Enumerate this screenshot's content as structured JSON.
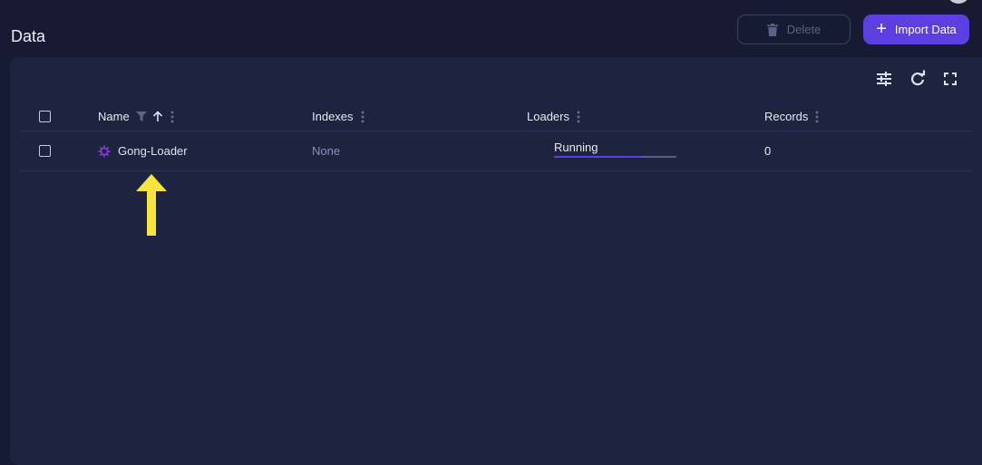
{
  "page": {
    "title": "Data"
  },
  "toolbar": {
    "delete_label": "Delete",
    "import_label": "Import Data",
    "icons": [
      "trash-icon",
      "plus-icon"
    ]
  },
  "table_tools": {
    "icons": [
      "column-settings-icon",
      "refresh-icon",
      "fullscreen-icon"
    ]
  },
  "table": {
    "columns": [
      {
        "label": "Name",
        "icons": [
          "filter-icon",
          "sort-asc-icon",
          "column-menu-icon"
        ]
      },
      {
        "label": "Indexes",
        "icons": [
          "column-menu-icon"
        ]
      },
      {
        "label": "Loaders",
        "icons": [
          "column-menu-icon"
        ]
      },
      {
        "label": "Records",
        "icons": [
          "column-menu-icon"
        ]
      }
    ],
    "rows": [
      {
        "name": "Gong-Loader",
        "icon": "loader-gear-icon",
        "indexes": "None",
        "loader_status": "Running",
        "loader_progress": 0.71,
        "records": "0"
      }
    ]
  },
  "annotation": {
    "icon": "yellow-up-arrow",
    "color": "#f7e443"
  },
  "colors": {
    "background": "#161b33",
    "panel": "#1e2440",
    "accent": "#5b3fe0",
    "muted_text": "#8a90b8",
    "loader_icon": "#8b3bd9"
  }
}
